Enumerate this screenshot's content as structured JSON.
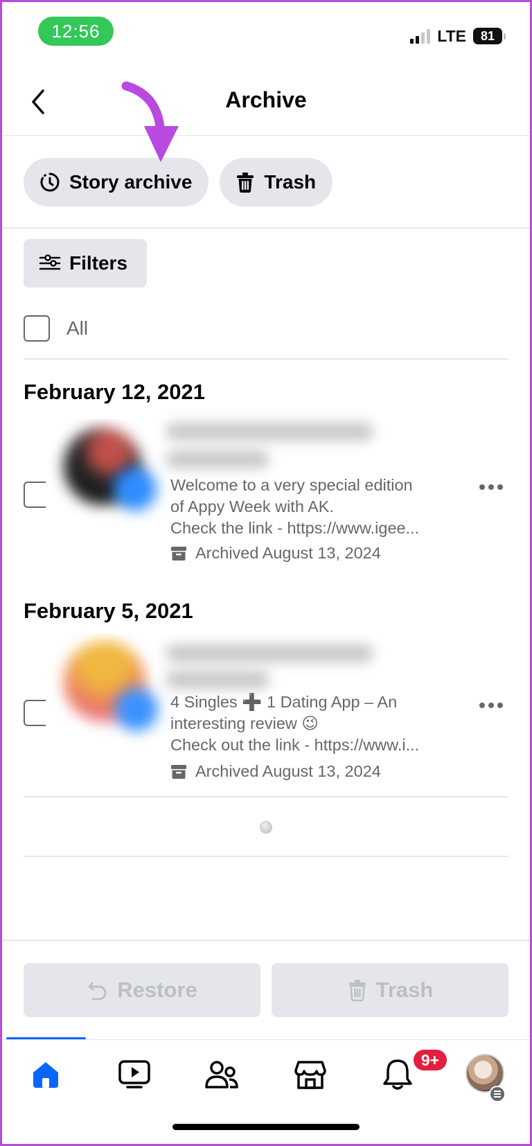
{
  "status_bar": {
    "time": "12:56",
    "network": "LTE",
    "battery": "81"
  },
  "header": {
    "title": "Archive"
  },
  "chips": {
    "story_archive": "Story archive",
    "trash": "Trash"
  },
  "filters": {
    "label": "Filters"
  },
  "select_all": {
    "label": "All"
  },
  "sections": [
    {
      "date": "February 12, 2021",
      "item": {
        "lines": [
          "Welcome to a very special edition",
          "of Appy Week with AK.",
          "Check the link - https://www.igee..."
        ],
        "archived": "Archived August 13, 2024"
      }
    },
    {
      "date": "February 5, 2021",
      "item": {
        "lines": [
          "4 Singles ➕ 1 Dating App – An",
          "interesting review 😉",
          "Check out the link - https://www.i..."
        ],
        "archived": "Archived August 13, 2024"
      }
    }
  ],
  "actions": {
    "restore": "Restore",
    "trash": "Trash"
  },
  "tabbar": {
    "notifications_badge": "9+",
    "tabs": [
      "home-icon",
      "video-icon",
      "friends-icon",
      "marketplace-icon",
      "bell-icon",
      "profile-avatar"
    ]
  },
  "colors": {
    "accent": "#0866ff",
    "annotation_arrow": "#b84ae0",
    "badge": "#e41e3f",
    "chip_bg": "#e4e6eb"
  }
}
